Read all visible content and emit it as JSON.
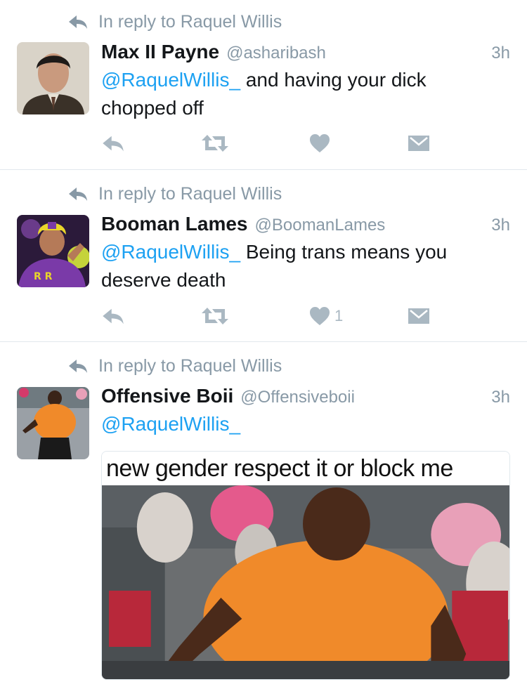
{
  "tweets": [
    {
      "context": "In reply to Raquel Willis",
      "name": "Max II Payne",
      "handle": "@asharibash",
      "time": "3h",
      "mention": "@RaquelWillis_",
      "text_line1": " and having your dick",
      "text_line2": "chopped off",
      "like_count": ""
    },
    {
      "context": "In reply to Raquel Willis",
      "name": "Booman Lames",
      "handle": "@BoomanLames",
      "time": "3h",
      "mention": "@RaquelWillis_",
      "text_line1": " Being trans means you",
      "text_line2": "deserve death",
      "like_count": "1"
    },
    {
      "context": "In reply to Raquel Willis",
      "name": "Offensive Boii",
      "handle": "@Offensiveboii",
      "time": "3h",
      "mention": "@RaquelWillis_",
      "media_caption": "new gender respect it or block me"
    }
  ],
  "colors": {
    "mention": "#1da1f2",
    "secondary": "#8899a6",
    "action_icon": "#aab8c2",
    "divider": "#e1e8ed"
  },
  "icons": {
    "context": "reply-arrow-icon",
    "actions": [
      "reply-icon",
      "retweet-icon",
      "heart-icon",
      "message-icon"
    ]
  }
}
